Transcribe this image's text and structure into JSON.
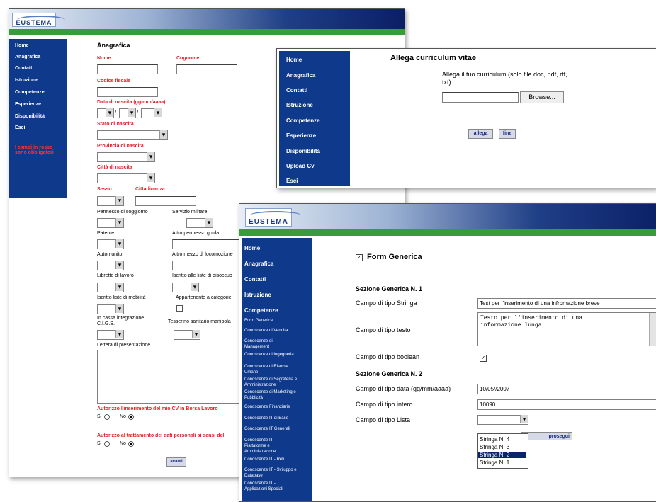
{
  "logo": "EUSTEMA",
  "win1": {
    "nav": [
      "Home",
      "Anagrafica",
      "Contatti",
      "Istruzione",
      "Competenze",
      "Esperienze",
      "Disponibilità",
      "Esci"
    ],
    "nav_note": "I campi in rosso sono obbligatori",
    "title": "Anagrafica",
    "nome": "Nome",
    "cognome": "Cognome",
    "codice_fiscale": "Codice fiscale",
    "data_nascita": "Data di nascita (gg/mm/aaaa)",
    "slash": "/",
    "stato_nascita": "Stato di nascita",
    "provincia_nascita": "Provincia di nascita",
    "citta_nascita": "Città di nascita",
    "sesso": "Sesso",
    "cittadinanza": "Cittadinanza",
    "permesso": "Permesso di soggiorno",
    "servizio": "Servizio militare",
    "patente": "Patente",
    "altro_permesso": "Altro permesso guida",
    "automunito": "Automunito",
    "altro_mezzo": "Altro mezzo di locomozione",
    "libretto": "Libretto di lavoro",
    "iscritto_disoc": "Iscritto alle liste di disoccup",
    "iscritto_mob": "Iscritto liste di mobilità",
    "appartenente": "Appartenente a categorie",
    "cassa": "In cassa integrazione C.I.G.S.",
    "tesserino": "Tesserino sanitario manipola",
    "lettera": "Lettera di presentazione",
    "autorizzo1": "Autorizzo l'inserimento del mio CV in Borsa Lavoro",
    "autorizzo2": "Autorizzo al trattamento dei dati personali ai sensi del",
    "si": "Sì",
    "no": "No",
    "avanti": "avanti"
  },
  "win2": {
    "nav": [
      "Home",
      "Anagrafica",
      "Contatti",
      "Istruzione",
      "Competenze",
      "Esperienze",
      "Disponibilità",
      "Upload Cv",
      "Esci"
    ],
    "title": "Allega curriculum vitae",
    "instr": "Allega il tuo curriculum (solo file doc, pdf, rtf, txt):",
    "browse": "Browse...",
    "allega": "allega",
    "fine": "fine"
  },
  "win3": {
    "nav_main": [
      "Home",
      "Anagrafica",
      "Contatti",
      "Istruzione",
      "Competenze"
    ],
    "nav_sub": [
      "Form Generica",
      "Conoscenze di Vendita",
      "Conoscenze di Management",
      "Conoscenze di Ingegneria",
      "Conoscenze di Risorse Umane",
      "Conoscenze di Segreteria e Amministrazione",
      "Conoscenze di Marketing e Pubblicità",
      "Conoscenze Finanziarie",
      "Conoscenze IT di Base",
      "Conoscenze IT Generali",
      "Conoscenze IT - Piattaforme e Amministrazione",
      "Conoscenze IT - Reti",
      "Conoscenze IT - Sviluppo e Database",
      "Conoscenze IT - Applicazioni Speciali"
    ],
    "form_title": "Form Generica",
    "sez1": "Sezione Generica N. 1",
    "stringa_lbl": "Campo di tipo Stringa",
    "stringa_val": "Test per l'inserimento di una infromazione breve",
    "testo_lbl": "Campo di tipo testo",
    "testo_val": "Testo per l'inserimento di una informazione lunga",
    "boolean_lbl": "Campo di tipo boolean",
    "sez2": "Sezione Generica N. 2",
    "data_lbl": "Campo di tipo data (gg/mm/aaaa)",
    "data_val": "10/05//2007",
    "intero_lbl": "Campo di tipo intero",
    "intero_val": "10090",
    "lista_lbl": "Campo di tipo Lista",
    "lista_options": [
      "Stringa N. 4",
      "Stringa N. 3",
      "Stringa N. 2",
      "Stringa N. 1"
    ],
    "prosegui": "prosegui"
  }
}
